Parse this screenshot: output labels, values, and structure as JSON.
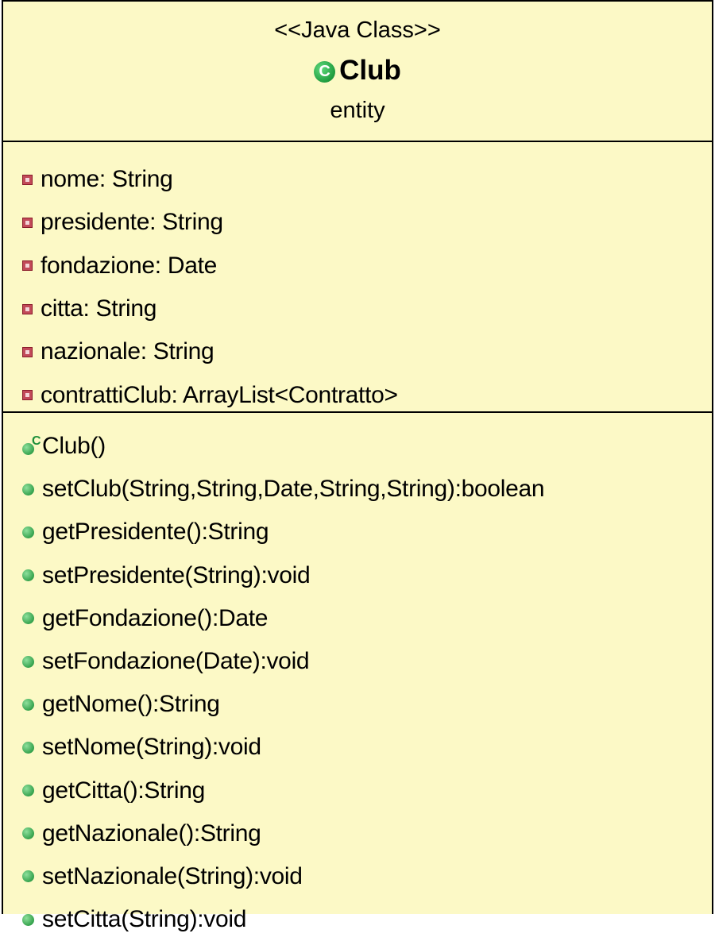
{
  "class": {
    "stereotype": "<<Java Class>>",
    "name": "Club",
    "icon_letter": "C",
    "package": "entity"
  },
  "attributes": [
    {
      "text": "nome: String",
      "visibility": "private"
    },
    {
      "text": "presidente: String",
      "visibility": "private"
    },
    {
      "text": "fondazione: Date",
      "visibility": "private"
    },
    {
      "text": "citta: String",
      "visibility": "private"
    },
    {
      "text": "nazionale: String",
      "visibility": "private"
    },
    {
      "text": "contrattiClub: ArrayList<Contratto>",
      "visibility": "private"
    }
  ],
  "operations": [
    {
      "text": "Club()",
      "visibility": "public",
      "constructor": true,
      "ctor_mark": "C"
    },
    {
      "text": "setClub(String,String,Date,String,String):boolean",
      "visibility": "public"
    },
    {
      "text": "getPresidente():String",
      "visibility": "public"
    },
    {
      "text": "setPresidente(String):void",
      "visibility": "public"
    },
    {
      "text": "getFondazione():Date",
      "visibility": "public"
    },
    {
      "text": "setFondazione(Date):void",
      "visibility": "public"
    },
    {
      "text": "getNome():String",
      "visibility": "public"
    },
    {
      "text": "setNome(String):void",
      "visibility": "public"
    },
    {
      "text": "getCitta():String",
      "visibility": "public"
    },
    {
      "text": "getNazionale():String",
      "visibility": "public"
    },
    {
      "text": "setNazionale(String):void",
      "visibility": "public"
    },
    {
      "text": "setCitta(String):void",
      "visibility": "public"
    }
  ],
  "colors": {
    "box_fill": "#fcf9c6",
    "border": "#000000",
    "private_icon": "#c24a59",
    "public_icon": "#2f9e47"
  },
  "icons": {
    "class": "class-icon",
    "private_member": "private-field-icon",
    "public_member": "public-method-icon",
    "constructor": "constructor-icon"
  }
}
